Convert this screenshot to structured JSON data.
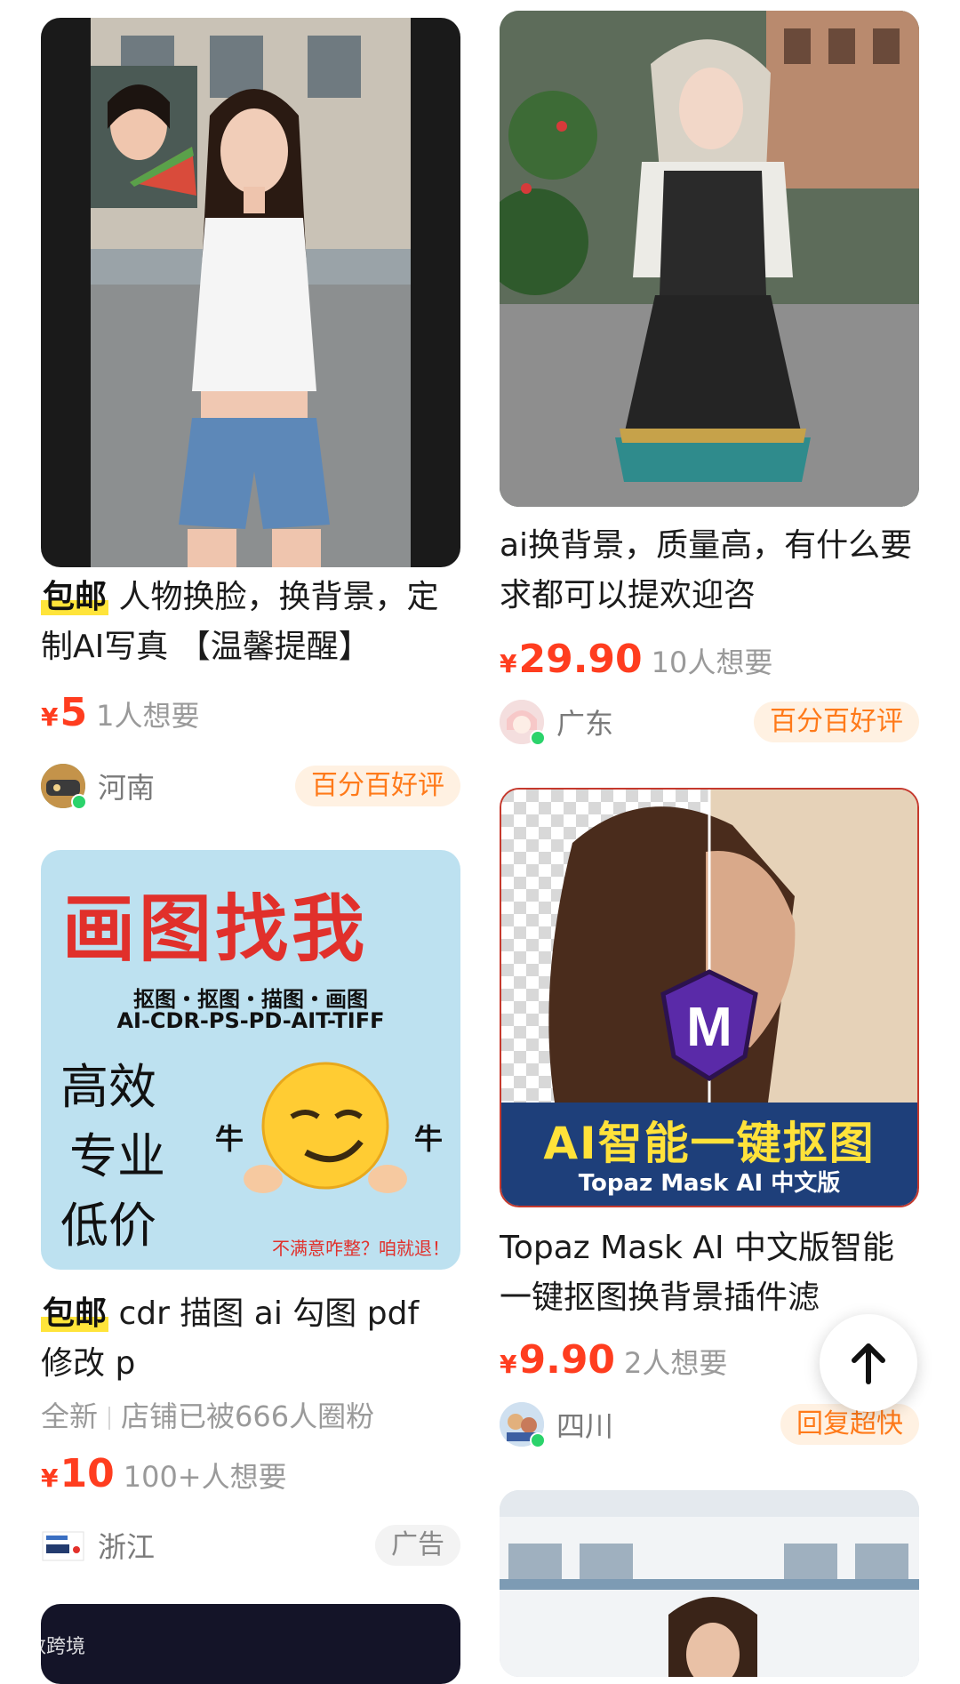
{
  "feed": {
    "left": [
      {
        "tag": "包邮",
        "title": "人物换脸，换背景，定制AI写真 【温馨提醒】",
        "yen": "¥",
        "price": "5",
        "wants": "1人想要",
        "location": "河南",
        "badge": "百分百好评"
      },
      {
        "poster_title": "画图找我",
        "poster_line1": "抠图・抠图・描图・画图",
        "poster_line2": "AI-CDR-PS-PD-AIT-TIFF",
        "poster_hand1": "高效",
        "poster_hand2": "专业",
        "poster_hand3": "低价",
        "poster_niu_left": "牛",
        "poster_niu_right": "牛",
        "poster_footer": "不满意咋整？咱就退！",
        "tag": "包邮",
        "title": "cdr 描图 ai 勾图 pdf 修改 p",
        "condition": "全新",
        "shop_fans": "店铺已被666人圈粉",
        "yen": "¥",
        "price": "10",
        "wants": "100+人想要",
        "location": "浙江",
        "badge": "广告"
      }
    ],
    "right": [
      {
        "title": "ai换背景，质量高，有什么要求都可以提欢迎咨",
        "yen": "¥",
        "price": "29.90",
        "wants": "10人想要",
        "location": "广东",
        "badge": "百分百好评"
      },
      {
        "banner_main": "AI智能一键抠图",
        "banner_sub": "Topaz Mask AI  中文版",
        "logo_letter": "M",
        "title": "Topaz Mask AI 中文版智能一键抠图换背景插件滤",
        "yen": "¥",
        "price": "9.90",
        "wants": "2人想要",
        "location": "四川",
        "badge": "回复超快"
      }
    ]
  },
  "watermark": "大数跨境",
  "colors": {
    "price": "#ff3d1f",
    "badge_text": "#ff7a1a",
    "badge_bg": "#fff1e2",
    "tag_highlight": "#ffe43a",
    "online_dot": "#2bd36b"
  },
  "icons": {
    "scroll_top": "arrow-up-icon"
  }
}
